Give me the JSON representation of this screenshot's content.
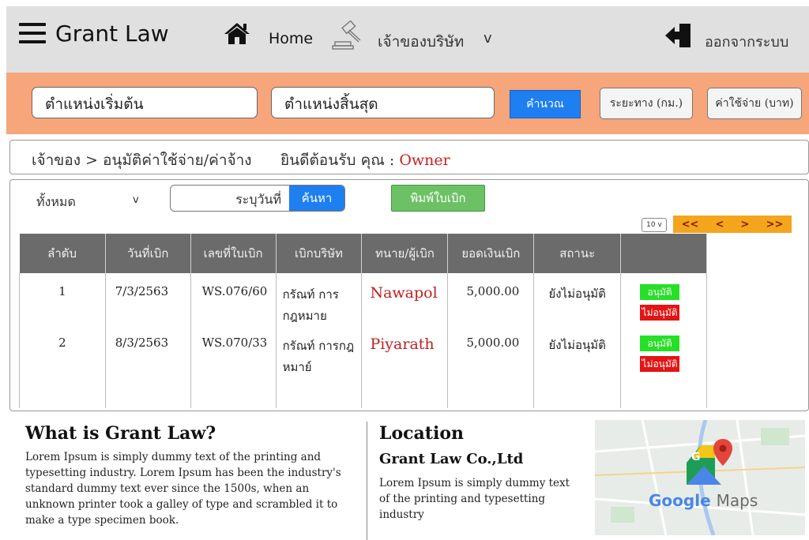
{
  "header": {
    "brand": "Grant Law",
    "home_label": "Home",
    "owner_menu_label": "เจ้าของบริษัท",
    "owner_menu_caret": "v",
    "logout_label": "ออกจากระบบ"
  },
  "route": {
    "start_value": "ตำแหน่งเริ่มต้น",
    "end_value": "ตำแหน่งสิ้นสุด",
    "calculate_label": "คำนวณ",
    "distance_label": "ระยะทาง (กม.)",
    "cost_label": "ค่าใช้จ่าย (บาท)"
  },
  "breadcrumb": "เจ้าของ > อนุมัติค่าใช้จ่าย/ค่าจ้าง",
  "welcome": {
    "prefix": "ยินดีต้อนรับ คุณ :",
    "user": "Owner"
  },
  "filters": {
    "status_value": "ทั้งหมด",
    "status_caret": "v",
    "date_placeholder": "ระบุวันที่",
    "search_label": "ค้นหา",
    "print_label": "พิมพ์ใบเบิก",
    "page_size": "10 v"
  },
  "pager": {
    "first": "<<",
    "prev": "<",
    "next": ">",
    "last": ">>"
  },
  "table": {
    "columns": [
      "ลำดับ",
      "วันที่เบิก",
      "เลขที่ใบเบิก",
      "เบิกบริษัท",
      "ทนาย/ผู้เบิก",
      "ยอดเงินเบิก",
      "สถานะ",
      ""
    ],
    "rows": [
      {
        "index": "1",
        "date": "7/3/2563",
        "number": "WS.076/60",
        "company": "กรัณท์ การกฎหมาย",
        "claimant": "Nawapol",
        "amount": "5,000.00",
        "status": "ยังไม่อนุมัติ",
        "approve": "อนุมัติ",
        "reject": "ไม่อนุมัติ"
      },
      {
        "index": "2",
        "date": "8/3/2563",
        "number": "WS.070/33",
        "company": "กรัณท์ การกฎหมาย์",
        "claimant": "Piyarath",
        "amount": "5,000.00",
        "status": "ยังไม่อนุมัติ",
        "approve": "อนุมัติ",
        "reject": "ไม่อนุมัติ"
      }
    ]
  },
  "footer": {
    "about_title": "What is Grant Law?",
    "about_text": "Lorem Ipsum is simply dummy text of the printing and typesetting industry. Lorem Ipsum has been the industry's standard dummy text ever since the 1500s, when an unknown printer took a galley of type and scrambled it to make a type specimen book.",
    "location_title": "Location",
    "company_name": "Grant Law Co.,Ltd",
    "location_text": "Lorem Ipsum is simply dummy text of the printing and typesetting industry",
    "map_caption_google": "Google",
    "map_caption_maps": "Maps"
  }
}
